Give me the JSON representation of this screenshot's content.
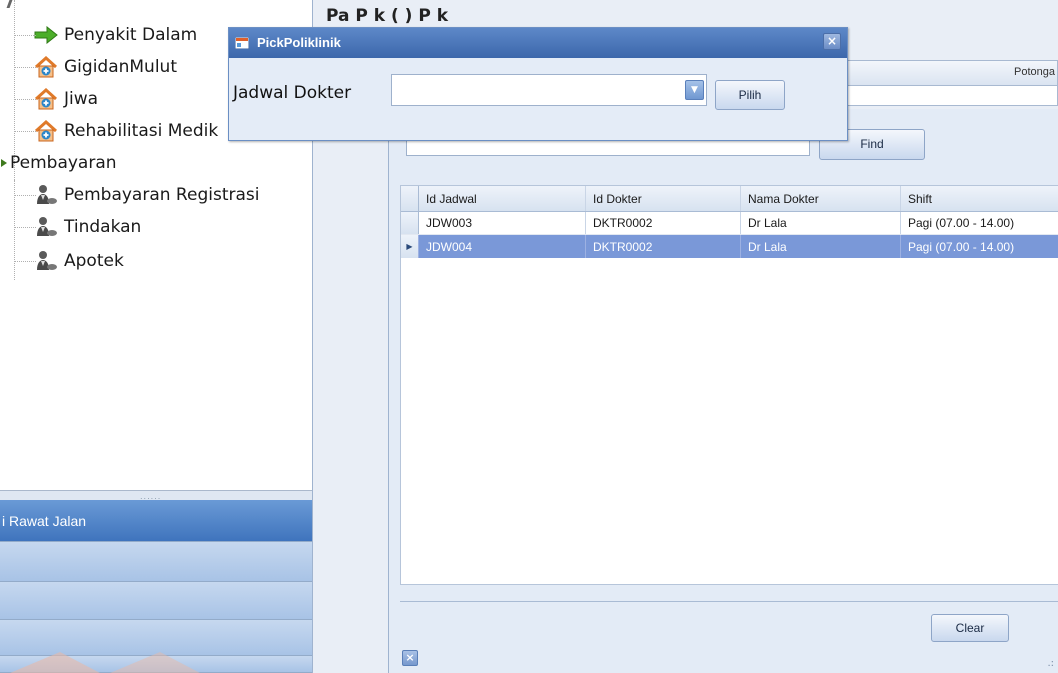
{
  "tree": {
    "items": [
      {
        "label": "Penyakit Dalam",
        "icon": "green-arrow-icon"
      },
      {
        "label": "GigidanMulut",
        "icon": "house-plus-icon"
      },
      {
        "label": "Jiwa",
        "icon": "house-plus-icon"
      },
      {
        "label": "Rehabilitasi Medik",
        "icon": "house-plus-icon"
      },
      {
        "label": "Pembayaran",
        "icon": "tree-node-icon"
      },
      {
        "label": "Pembayaran Registrasi",
        "icon": "cashier-icon"
      },
      {
        "label": "Tindakan",
        "icon": "cashier-icon"
      },
      {
        "label": "Apotek",
        "icon": "cashier-icon"
      }
    ]
  },
  "nav": {
    "splitter_dots": "......",
    "active_label": "i Rawat Jalan"
  },
  "background": {
    "title_fragment": "Pa  P  k  (  )  P  k",
    "grid_header": "Potonga"
  },
  "dialog": {
    "title": "PickPoliklinik",
    "close_glyph": "×",
    "label": "Jadwal Dokter",
    "combo_value": "",
    "pilih_label": "Pilih"
  },
  "panel": {
    "find_value": "",
    "find_label": "Find",
    "clear_label": "Clear",
    "grid": {
      "columns": [
        "Id Jadwal",
        "Id Dokter",
        "Nama Dokter",
        "Shift"
      ],
      "rows": [
        {
          "id_jadwal": "JDW003",
          "id_dokter": "DKTR0002",
          "nama_dokter": "Dr Lala",
          "shift": "Pagi  (07.00 - 14.00)"
        },
        {
          "id_jadwal": "JDW004",
          "id_dokter": "DKTR0002",
          "nama_dokter": "Dr Lala",
          "shift": "Pagi  (07.00 - 14.00)"
        }
      ],
      "selected_row": 2
    }
  },
  "colors": {
    "title_bar": "#3c67ab",
    "selected_row": "#7a98d8",
    "panel_bg": "#e3ebf6"
  }
}
